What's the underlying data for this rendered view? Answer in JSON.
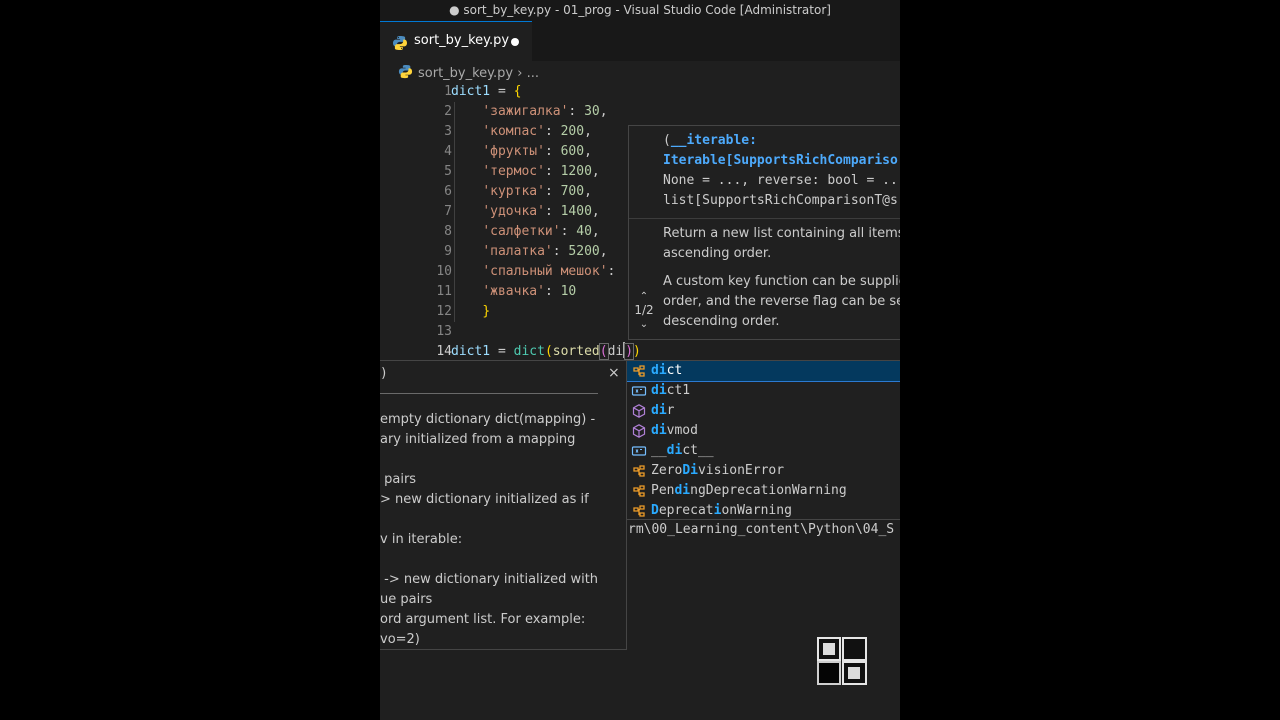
{
  "window": {
    "title": "● sort_by_key.py - 01_prog - Visual Studio Code [Administrator]"
  },
  "tab": {
    "label": "sort_by_key.py",
    "dirty": true,
    "icon": "python-file-icon"
  },
  "breadcrumb": {
    "file": "sort_by_key.py",
    "chevron": "›",
    "more": "..."
  },
  "editor": {
    "line_numbers": [
      "1",
      "2",
      "3",
      "4",
      "5",
      "6",
      "7",
      "8",
      "9",
      "10",
      "11",
      "12",
      "13",
      "14"
    ],
    "line1": {
      "var": "dict1",
      "op": " = ",
      "brace": "{"
    },
    "entries": [
      {
        "key": "'зажигалка'",
        "val": "30",
        "tail": ","
      },
      {
        "key": "'компас'",
        "val": "200",
        "tail": ","
      },
      {
        "key": "'фрукты'",
        "val": "600",
        "tail": ","
      },
      {
        "key": "'термос'",
        "val": "1200",
        "tail": ","
      },
      {
        "key": "'куртка'",
        "val": "700",
        "tail": ","
      },
      {
        "key": "'удочка'",
        "val": "1400",
        "tail": ","
      },
      {
        "key": "'салфетки'",
        "val": "40",
        "tail": ","
      },
      {
        "key": "'палатка'",
        "val": "5200",
        "tail": ","
      },
      {
        "key": "'спальный мешок'",
        "val": "",
        "tail": ""
      },
      {
        "key": "'жвачка'",
        "val": "10",
        "tail": ""
      }
    ],
    "line12": {
      "brace": "}"
    },
    "line14": {
      "var": "dict1",
      "op": " = ",
      "dict": "dict",
      "paren1": "(",
      "sorted": "sorted",
      "paren2": "(",
      "typed": "di",
      "paren3": ")",
      "paren4": ")"
    }
  },
  "signature_help": {
    "open": "(",
    "param": "__iterable:",
    "line2": "Iterable[SupportsRichCompariso",
    "line3": "None = ..., reverse: bool = ..",
    "line4": "list[SupportsRichComparisonT@s",
    "doc1a": "Return a new list containing all items",
    "doc1b": "ascending order.",
    "doc2a": "A custom key function can be supplie",
    "doc2b": "order, and the reverse flag can be set",
    "doc2c": "descending order.",
    "page": "1/2",
    "up": "⌃",
    "down": "⌄"
  },
  "suggestion_details": {
    "header": ")",
    "close": "×",
    "doc": "empty dictionary dict(mapping) -\nary initialized from a mapping\n\n pairs\n> new dictionary initialized as if\n\nv in iterable:\n\n -> new dictionary initialized with\nue pairs\nord argument list. For example:\nvo=2)"
  },
  "suggestions": [
    {
      "pre": "",
      "m1": "di",
      "rest": "ct",
      "kind": "class-icon",
      "selected": true
    },
    {
      "pre": "",
      "m1": "di",
      "rest": "ct1",
      "kind": "variable-icon",
      "selected": false
    },
    {
      "pre": "",
      "m1": "di",
      "rest": "r",
      "kind": "function-icon",
      "selected": false
    },
    {
      "pre": "",
      "m1": "di",
      "rest": "vmod",
      "kind": "function-icon",
      "selected": false
    },
    {
      "pre": "__",
      "m1": "di",
      "rest": "ct__",
      "kind": "variable-icon",
      "selected": false
    },
    {
      "pre": "Zero",
      "m1": "Di",
      "rest": "visionError",
      "kind": "class-icon",
      "selected": false
    },
    {
      "pre": "Pen",
      "m1": "di",
      "rest": "ngDeprecationWarning",
      "kind": "class-icon",
      "selected": false
    },
    {
      "pre": "",
      "m1": "D",
      "mid": "eprecat",
      "m2": "i",
      "rest": "onWarning",
      "kind": "class-icon",
      "selected": false
    }
  ],
  "hover_path": "rm\\00_Learning_content\\Python\\04_S",
  "colors": {
    "editor_bg": "#1f1f1f",
    "string": "#ce9178",
    "number": "#b5cea8",
    "variable": "#9cdcfe",
    "function": "#dcdcaa",
    "class": "#4ec9b0",
    "match_highlight": "#2aaaff",
    "selection_bg": "#04395e"
  },
  "watermark_logo": "channel-logo"
}
